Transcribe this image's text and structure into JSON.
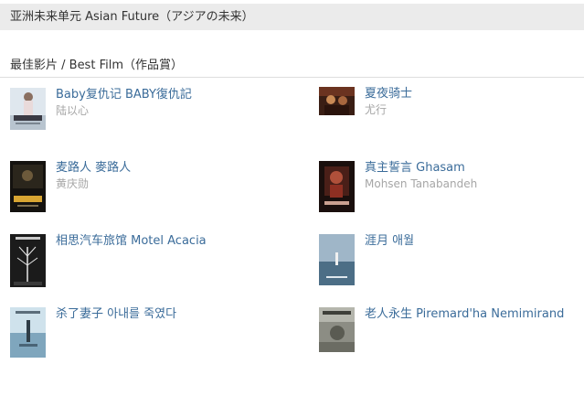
{
  "section": {
    "title": "亚洲未来单元 Asian Future（アジアの未来）"
  },
  "award": {
    "title": "最佳影片 / Best Film（作品賞）"
  },
  "films": [
    {
      "title": "Baby复仇记 BABY復仇記",
      "director": "陆以心",
      "poster_icon": "movie-poster"
    },
    {
      "title": "夏夜骑士",
      "director": "尤行",
      "poster_icon": "movie-poster"
    },
    {
      "title": "麦路人 麥路人",
      "director": "黄庆勋",
      "poster_icon": "movie-poster"
    },
    {
      "title": "真主誓言 Ghasam",
      "director": "Mohsen Tanabandeh",
      "poster_icon": "movie-poster"
    },
    {
      "title": "相思汽车旅馆 Motel Acacia",
      "director": "",
      "poster_icon": "movie-poster"
    },
    {
      "title": "涯月 애월",
      "director": "",
      "poster_icon": "movie-poster"
    },
    {
      "title": "杀了妻子 아내를 죽였다",
      "director": "",
      "poster_icon": "movie-poster"
    },
    {
      "title": "老人永生 Piremard'ha Nemimirand",
      "director": "",
      "poster_icon": "movie-poster"
    }
  ],
  "colors": {
    "link": "#3b6c9a",
    "director": "#a6a6a6",
    "header_bg": "#ebebeb"
  }
}
